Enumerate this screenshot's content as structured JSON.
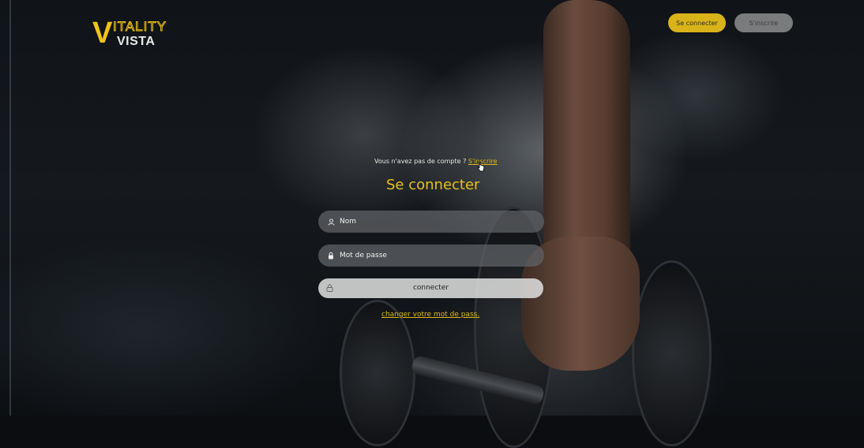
{
  "brand": {
    "logo_letter": "V",
    "logo_top": "ITALITY",
    "logo_bottom": "VISTA",
    "accent": "#e7c11a"
  },
  "nav": {
    "login_label": "Se connecter",
    "signup_label": "S'inscrire"
  },
  "login": {
    "no_account_text": "Vous n'avez pas de compte ?",
    "no_account_link": "S'inscrire",
    "title": "Se connecter",
    "name_placeholder": "Nom",
    "password_placeholder": "Mot de passe",
    "submit_label": "connecter",
    "change_password_link": "changer votre mot de pass."
  },
  "icons": {
    "name_field": "user-icon",
    "password_field": "lock-icon",
    "submit": "lock-icon"
  }
}
